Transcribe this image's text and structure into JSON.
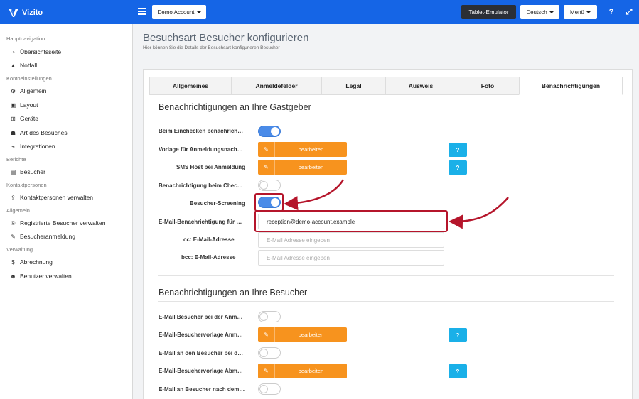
{
  "header": {
    "brand": "Vizito",
    "account_button": "Demo Account",
    "tablet_button": "Tablet-Emulator",
    "language_button": "Deutsch",
    "menu_button": "Menü",
    "help_icon": "?",
    "expand_icon": "⤢"
  },
  "sidebar": {
    "sections": [
      {
        "title": "Hauptnavigation",
        "items": [
          {
            "icon": "gauge-icon",
            "label": "Übersichtsseite"
          },
          {
            "icon": "warning-icon",
            "label": "Notfall"
          }
        ]
      },
      {
        "title": "Kontoeinstellungen",
        "items": [
          {
            "icon": "gear-icon",
            "label": "Allgemein"
          },
          {
            "icon": "image-icon",
            "label": "Layout"
          },
          {
            "icon": "sitemap-icon",
            "label": "Geräte"
          },
          {
            "icon": "users-icon",
            "label": "Art des Besuches"
          },
          {
            "icon": "plug-icon",
            "label": "Integrationen"
          }
        ]
      },
      {
        "title": "Berichte",
        "items": [
          {
            "icon": "list-icon",
            "label": "Besucher"
          }
        ]
      },
      {
        "title": "Kontaktpersonen",
        "items": [
          {
            "icon": "upload-icon",
            "label": "Kontaktpersonen verwalten"
          }
        ]
      },
      {
        "title": "Allgemein",
        "items": [
          {
            "icon": "registered-icon",
            "label": "Registrierte Besucher verwalten"
          },
          {
            "icon": "pencil-icon",
            "label": "Besucheranmeldung"
          }
        ]
      },
      {
        "title": "Verwaltung",
        "items": [
          {
            "icon": "dollar-icon",
            "label": "Abrechnung"
          },
          {
            "icon": "user-plus-icon",
            "label": "Benutzer verwalten"
          }
        ]
      }
    ]
  },
  "page": {
    "title": "Besuchsart Besucher konfigurieren",
    "subtitle": "Hier können Sie die Details der Besuchsart konfigurieren Besucher"
  },
  "tabs": [
    "Allgemeines",
    "Anmeldefelder",
    "Legal",
    "Ausweis",
    "Foto",
    "Benachrichtigungen"
  ],
  "active_tab": "Benachrichtigungen",
  "host_section": {
    "heading": "Benachrichtigungen an Ihre Gastgeber",
    "rows": {
      "checkin_label": "Beim Einchecken benachrich…",
      "checkin_on": true,
      "template_label": "Vorlage für Anmeldungsnach…",
      "template_button": "bearbeiten",
      "sms_label": "SMS Host bei Anmeldung",
      "sms_button": "bearbeiten",
      "checkout_label": "Benachrichtigung beim Chec…",
      "checkout_on": false,
      "screening_label": "Besucher-Screening",
      "screening_on": true,
      "email_label": "E-Mail-Benachrichtigung für …",
      "email_value": "reception@demo-account.example",
      "cc_label": "cc: E-Mail-Adresse",
      "cc_placeholder": "E-Mail Adresse eingeben",
      "bcc_label": "bcc: E-Mail-Adresse",
      "bcc_placeholder": "E-Mail Adresse eingeben",
      "help": "?"
    }
  },
  "visitor_section": {
    "heading": "Benachrichtigungen an Ihre Besucher",
    "rows": {
      "email_checkin_label": "E-Mail Besucher bei der Anm…",
      "email_checkin_on": false,
      "template_checkin_label": "E-Mail-Besuchervorlage Anm…",
      "template_checkin_button": "bearbeiten",
      "email_checkout_label": "E-Mail an den Besucher bei d…",
      "email_checkout_on": false,
      "template_checkout_label": "E-Mail-Besuchervorlage Abm…",
      "template_checkout_button": "bearbeiten",
      "email_after_label": "E-Mail an Besucher nach dem…",
      "email_after_on": false
    }
  },
  "colors": {
    "topbar": "#1565e6",
    "accent_orange": "#f7931e",
    "help_blue": "#1ab0e8",
    "toggle_on": "#4a8be8",
    "highlight_red": "#b5152b"
  }
}
